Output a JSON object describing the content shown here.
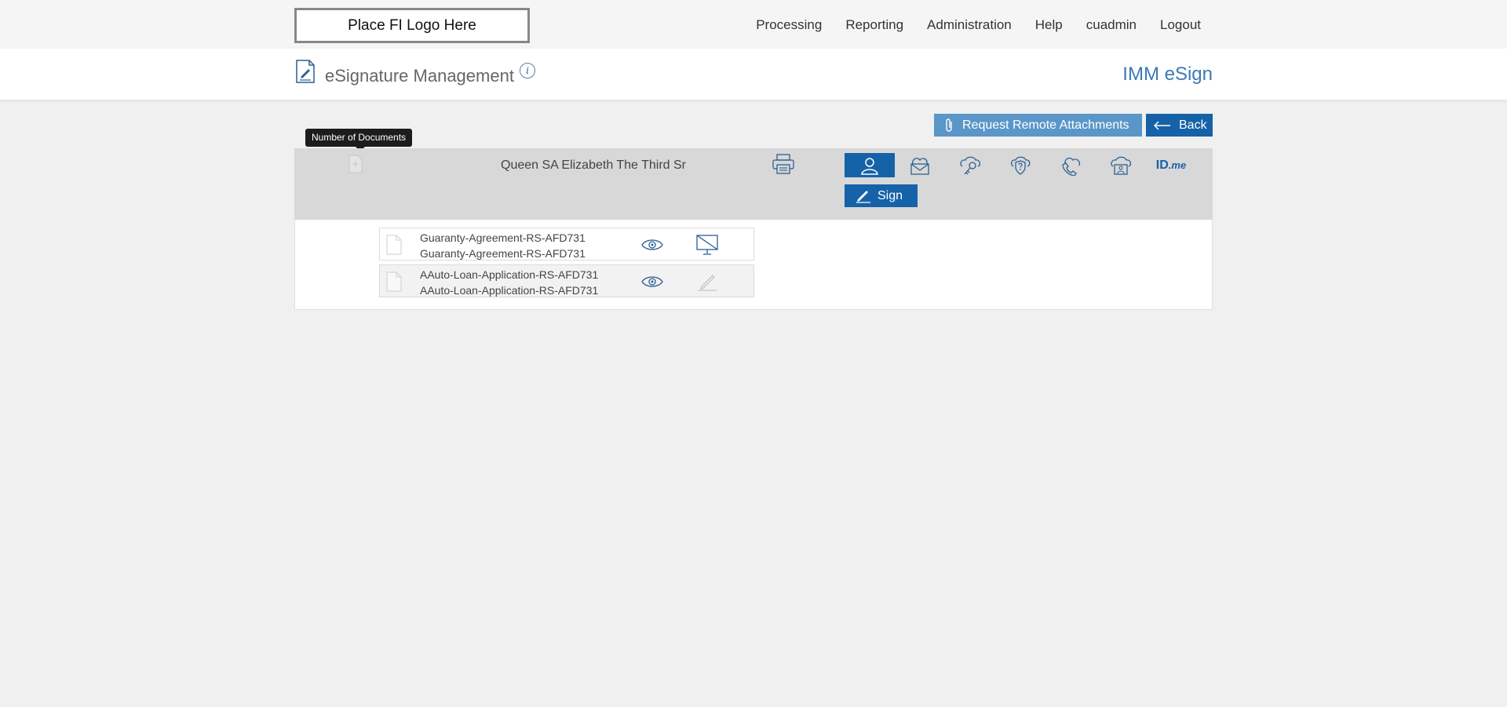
{
  "header": {
    "logo_text": "Place FI Logo Here",
    "nav": [
      "Processing",
      "Reporting",
      "Administration",
      "Help",
      "cuadmin",
      "Logout"
    ]
  },
  "titlebar": {
    "page_title": "eSignature Management",
    "info_glyph": "i",
    "brand": "IMM eSign"
  },
  "actions": {
    "request_attachments": "Request Remote Attachments",
    "back": "Back"
  },
  "tooltip": "Number of Documents",
  "signer": {
    "name": "Queen SA Elizabeth The Third Sr",
    "auth_methods": [
      "user-icon",
      "email-icon",
      "key-icon",
      "security-question-icon",
      "phone-icon",
      "id-card-icon",
      "idme-logo"
    ],
    "idme_text": "ID",
    "idme_suffix": ".me",
    "sign_label": "Sign"
  },
  "documents": [
    {
      "name": "Guaranty-Agreement-RS-AFD731",
      "subname": "Guaranty-Agreement-RS-AFD731",
      "action_icon": "no-screen-icon"
    },
    {
      "name": "AAuto-Loan-Application-RS-AFD731",
      "subname": "AAuto-Loan-Application-RS-AFD731",
      "action_icon": "sign-pen-icon"
    }
  ],
  "colors": {
    "primary": "#1562a8",
    "secondary_button": "#5b96c8",
    "brand_text": "#3a7ab8"
  }
}
